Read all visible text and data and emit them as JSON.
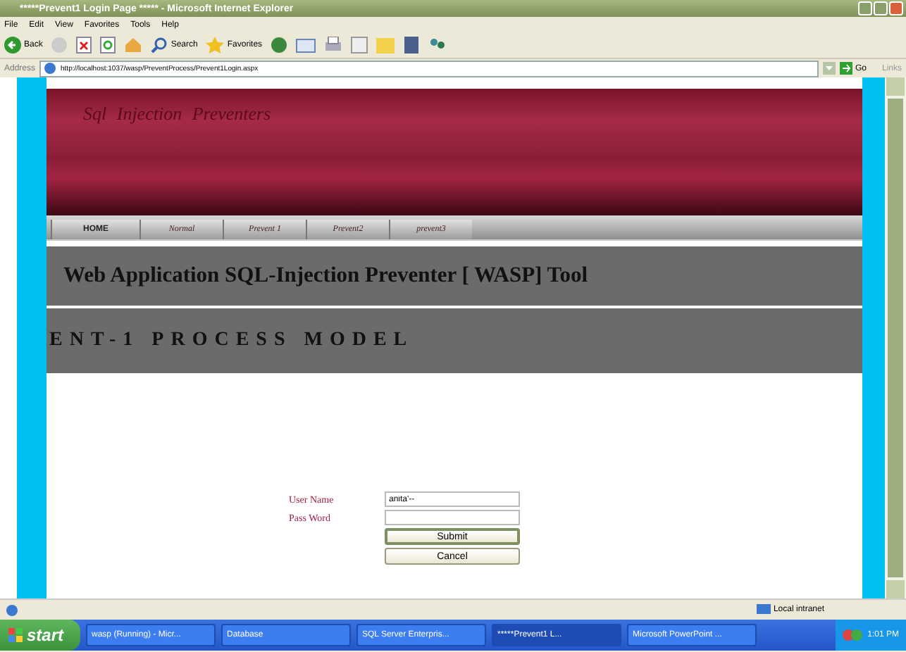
{
  "window": {
    "title": "*****Prevent1 Login Page ***** - Microsoft Internet Explorer"
  },
  "menu": [
    "File",
    "Edit",
    "View",
    "Favorites",
    "Tools",
    "Help"
  ],
  "toolbar": {
    "back": "Back",
    "search": "Search",
    "favorites": "Favorites"
  },
  "address": {
    "label": "Address",
    "url": "http://localhost:1037/wasp/PreventProcess/Prevent1Login.aspx",
    "go": "Go",
    "links": "Links"
  },
  "page": {
    "brand": "Sql Injection Preventers",
    "tabs": [
      {
        "label": "HOME",
        "selected": true
      },
      {
        "label": "Normal",
        "selected": false
      },
      {
        "label": "Prevent 1",
        "selected": false
      },
      {
        "label": "Prevent2",
        "selected": false
      },
      {
        "label": "prevent3",
        "selected": false
      }
    ],
    "heading": "Web Application SQL-Injection Preventer [ WASP] Tool",
    "subheading": "ENT-1 PROCESS MODEL",
    "form": {
      "user_label": "User Name",
      "user_value": "anita'--",
      "pass_label": "Pass Word",
      "submit": "Submit",
      "cancel": "Cancel"
    }
  },
  "status_bar": {
    "zone": "Local intranet"
  },
  "taskbar": {
    "start": "start",
    "items": [
      {
        "label": "wasp (Running) - Micr...",
        "selected": false
      },
      {
        "label": "Database",
        "selected": false
      },
      {
        "label": "SQL Server Enterpris...",
        "selected": false
      },
      {
        "label": "*****Prevent1 L...",
        "selected": true
      },
      {
        "label": "Microsoft PowerPoint ...",
        "selected": false
      }
    ],
    "clock": "1:01 PM"
  }
}
